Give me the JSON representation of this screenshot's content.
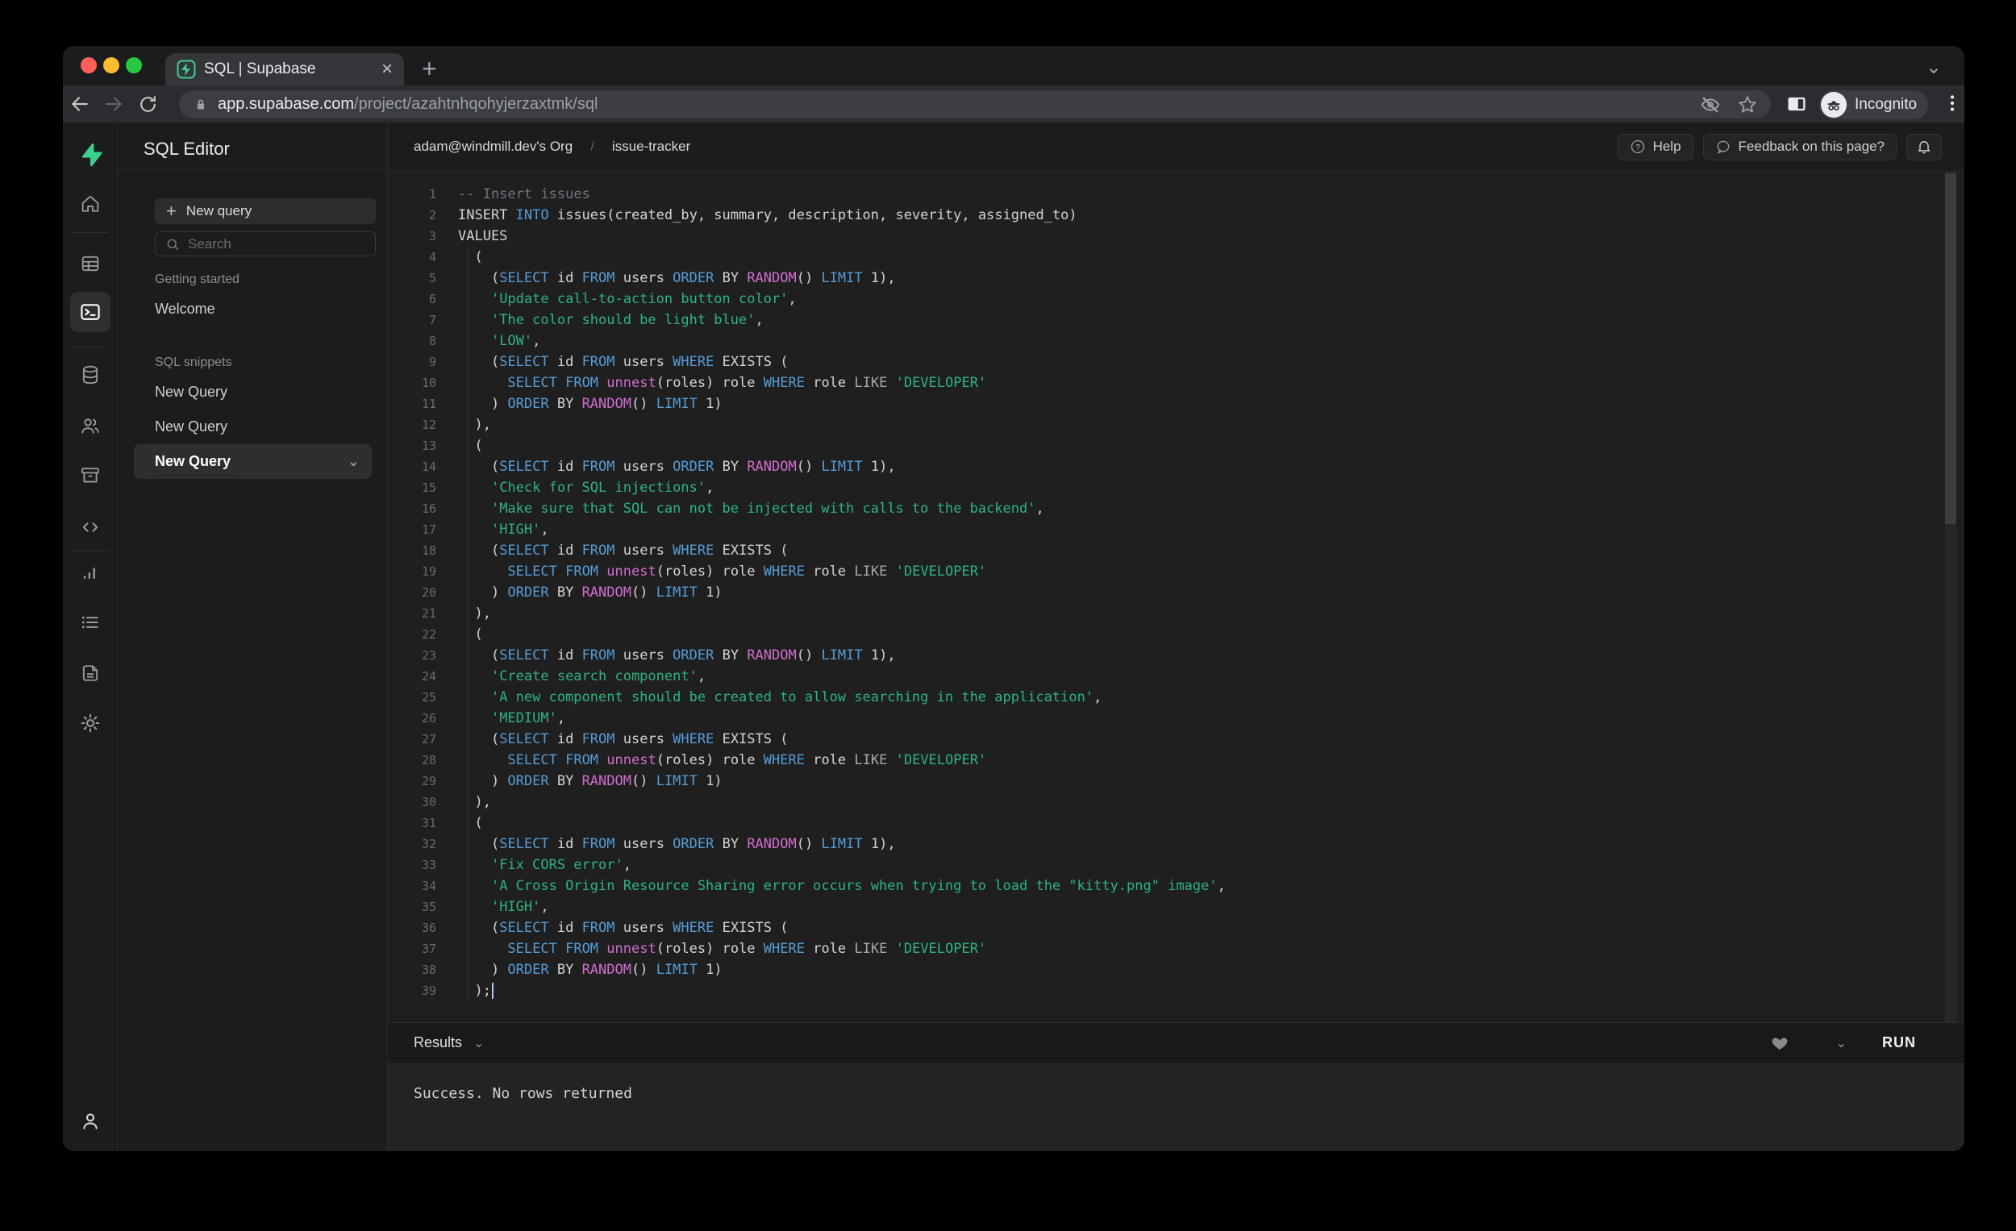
{
  "browser": {
    "tab_title": "SQL | Supabase",
    "close_glyph": "×",
    "plus_glyph": "+",
    "chevron_glyph": "⌄",
    "kebab_glyph": "⋮",
    "url_host": "app.supabase.com",
    "url_path": "/project/azahtnhqohyjerzaxtmk/sql",
    "incognito_label": "Incognito"
  },
  "header": {
    "breadcrumb_org": "adam@windmill.dev's Org",
    "breadcrumb_sep": "/",
    "breadcrumb_project": "issue-tracker",
    "help_label": "Help",
    "feedback_label": "Feedback on this page?"
  },
  "sidebar_panel": {
    "title": "SQL Editor",
    "new_query_button": "New query",
    "search_placeholder": "Search",
    "sections": [
      {
        "label": "Getting started",
        "items": [
          {
            "label": "Welcome",
            "active": false
          }
        ]
      },
      {
        "label": "SQL snippets",
        "items": [
          {
            "label": "New Query",
            "active": false
          },
          {
            "label": "New Query",
            "active": false
          },
          {
            "label": "New Query",
            "active": true
          }
        ]
      }
    ],
    "active_item_chevron": "⌄"
  },
  "results": {
    "label": "Results",
    "chevron": "⌄",
    "run_label": "RUN",
    "message": "Success. No rows returned"
  },
  "colors": {
    "accent_green": "#3ecf8e",
    "keyword_blue": "#569cd6",
    "function_magenta": "#d16dce",
    "string_green": "#2db47e",
    "comment_gray": "#6e7681",
    "mac_close": "#ff5f57",
    "mac_minimize": "#febc2e",
    "mac_zoom": "#28c840"
  },
  "editor": {
    "cursor_line": 39,
    "lines": [
      [
        [
          "c",
          "-- Insert issues"
        ]
      ],
      [
        [
          "d",
          "INSERT "
        ],
        [
          "k",
          "INTO"
        ],
        [
          "d",
          " issues(created_by, summary, description, severity, assigned_to)"
        ]
      ],
      [
        [
          "d",
          "VALUES"
        ]
      ],
      [
        [
          "d",
          "  ("
        ]
      ],
      [
        [
          "d",
          "    ("
        ],
        [
          "k",
          "SELECT"
        ],
        [
          "d",
          " id "
        ],
        [
          "k",
          "FROM"
        ],
        [
          "d",
          " users "
        ],
        [
          "k",
          "ORDER"
        ],
        [
          "d",
          " BY "
        ],
        [
          "f",
          "RANDOM"
        ],
        [
          "d",
          "() "
        ],
        [
          "k",
          "LIMIT"
        ],
        [
          "d",
          " 1),"
        ]
      ],
      [
        [
          "d",
          "    "
        ],
        [
          "s",
          "'Update call-to-action button color'"
        ],
        [
          "d",
          ","
        ]
      ],
      [
        [
          "d",
          "    "
        ],
        [
          "s",
          "'The color should be light blue'"
        ],
        [
          "d",
          ","
        ]
      ],
      [
        [
          "d",
          "    "
        ],
        [
          "s",
          "'LOW'"
        ],
        [
          "d",
          ","
        ]
      ],
      [
        [
          "d",
          "    ("
        ],
        [
          "k",
          "SELECT"
        ],
        [
          "d",
          " id "
        ],
        [
          "k",
          "FROM"
        ],
        [
          "d",
          " users "
        ],
        [
          "k",
          "WHERE"
        ],
        [
          "d",
          " EXISTS ("
        ]
      ],
      [
        [
          "d",
          "      "
        ],
        [
          "k",
          "SELECT"
        ],
        [
          "d",
          " "
        ],
        [
          "k",
          "FROM"
        ],
        [
          "d",
          " "
        ],
        [
          "f",
          "unnest"
        ],
        [
          "d",
          "(roles) role "
        ],
        [
          "k",
          "WHERE"
        ],
        [
          "d",
          " role "
        ],
        [
          "g",
          "LIKE"
        ],
        [
          "d",
          " "
        ],
        [
          "s",
          "'DEVELOPER'"
        ]
      ],
      [
        [
          "d",
          "    ) "
        ],
        [
          "k",
          "ORDER"
        ],
        [
          "d",
          " BY "
        ],
        [
          "f",
          "RANDOM"
        ],
        [
          "d",
          "() "
        ],
        [
          "k",
          "LIMIT"
        ],
        [
          "d",
          " 1)"
        ]
      ],
      [
        [
          "d",
          "  ),"
        ]
      ],
      [
        [
          "d",
          "  ("
        ]
      ],
      [
        [
          "d",
          "    ("
        ],
        [
          "k",
          "SELECT"
        ],
        [
          "d",
          " id "
        ],
        [
          "k",
          "FROM"
        ],
        [
          "d",
          " users "
        ],
        [
          "k",
          "ORDER"
        ],
        [
          "d",
          " BY "
        ],
        [
          "f",
          "RANDOM"
        ],
        [
          "d",
          "() "
        ],
        [
          "k",
          "LIMIT"
        ],
        [
          "d",
          " 1),"
        ]
      ],
      [
        [
          "d",
          "    "
        ],
        [
          "s",
          "'Check for SQL injections'"
        ],
        [
          "d",
          ","
        ]
      ],
      [
        [
          "d",
          "    "
        ],
        [
          "s",
          "'Make sure that SQL can not be injected with calls to the backend'"
        ],
        [
          "d",
          ","
        ]
      ],
      [
        [
          "d",
          "    "
        ],
        [
          "s",
          "'HIGH'"
        ],
        [
          "d",
          ","
        ]
      ],
      [
        [
          "d",
          "    ("
        ],
        [
          "k",
          "SELECT"
        ],
        [
          "d",
          " id "
        ],
        [
          "k",
          "FROM"
        ],
        [
          "d",
          " users "
        ],
        [
          "k",
          "WHERE"
        ],
        [
          "d",
          " EXISTS ("
        ]
      ],
      [
        [
          "d",
          "      "
        ],
        [
          "k",
          "SELECT"
        ],
        [
          "d",
          " "
        ],
        [
          "k",
          "FROM"
        ],
        [
          "d",
          " "
        ],
        [
          "f",
          "unnest"
        ],
        [
          "d",
          "(roles) role "
        ],
        [
          "k",
          "WHERE"
        ],
        [
          "d",
          " role "
        ],
        [
          "g",
          "LIKE"
        ],
        [
          "d",
          " "
        ],
        [
          "s",
          "'DEVELOPER'"
        ]
      ],
      [
        [
          "d",
          "    ) "
        ],
        [
          "k",
          "ORDER"
        ],
        [
          "d",
          " BY "
        ],
        [
          "f",
          "RANDOM"
        ],
        [
          "d",
          "() "
        ],
        [
          "k",
          "LIMIT"
        ],
        [
          "d",
          " 1)"
        ]
      ],
      [
        [
          "d",
          "  ),"
        ]
      ],
      [
        [
          "d",
          "  ("
        ]
      ],
      [
        [
          "d",
          "    ("
        ],
        [
          "k",
          "SELECT"
        ],
        [
          "d",
          " id "
        ],
        [
          "k",
          "FROM"
        ],
        [
          "d",
          " users "
        ],
        [
          "k",
          "ORDER"
        ],
        [
          "d",
          " BY "
        ],
        [
          "f",
          "RANDOM"
        ],
        [
          "d",
          "() "
        ],
        [
          "k",
          "LIMIT"
        ],
        [
          "d",
          " 1),"
        ]
      ],
      [
        [
          "d",
          "    "
        ],
        [
          "s",
          "'Create search component'"
        ],
        [
          "d",
          ","
        ]
      ],
      [
        [
          "d",
          "    "
        ],
        [
          "s",
          "'A new component should be created to allow searching in the application'"
        ],
        [
          "d",
          ","
        ]
      ],
      [
        [
          "d",
          "    "
        ],
        [
          "s",
          "'MEDIUM'"
        ],
        [
          "d",
          ","
        ]
      ],
      [
        [
          "d",
          "    ("
        ],
        [
          "k",
          "SELECT"
        ],
        [
          "d",
          " id "
        ],
        [
          "k",
          "FROM"
        ],
        [
          "d",
          " users "
        ],
        [
          "k",
          "WHERE"
        ],
        [
          "d",
          " EXISTS ("
        ]
      ],
      [
        [
          "d",
          "      "
        ],
        [
          "k",
          "SELECT"
        ],
        [
          "d",
          " "
        ],
        [
          "k",
          "FROM"
        ],
        [
          "d",
          " "
        ],
        [
          "f",
          "unnest"
        ],
        [
          "d",
          "(roles) role "
        ],
        [
          "k",
          "WHERE"
        ],
        [
          "d",
          " role "
        ],
        [
          "g",
          "LIKE"
        ],
        [
          "d",
          " "
        ],
        [
          "s",
          "'DEVELOPER'"
        ]
      ],
      [
        [
          "d",
          "    ) "
        ],
        [
          "k",
          "ORDER"
        ],
        [
          "d",
          " BY "
        ],
        [
          "f",
          "RANDOM"
        ],
        [
          "d",
          "() "
        ],
        [
          "k",
          "LIMIT"
        ],
        [
          "d",
          " 1)"
        ]
      ],
      [
        [
          "d",
          "  ),"
        ]
      ],
      [
        [
          "d",
          "  ("
        ]
      ],
      [
        [
          "d",
          "    ("
        ],
        [
          "k",
          "SELECT"
        ],
        [
          "d",
          " id "
        ],
        [
          "k",
          "FROM"
        ],
        [
          "d",
          " users "
        ],
        [
          "k",
          "ORDER"
        ],
        [
          "d",
          " BY "
        ],
        [
          "f",
          "RANDOM"
        ],
        [
          "d",
          "() "
        ],
        [
          "k",
          "LIMIT"
        ],
        [
          "d",
          " 1),"
        ]
      ],
      [
        [
          "d",
          "    "
        ],
        [
          "s",
          "'Fix CORS error'"
        ],
        [
          "d",
          ","
        ]
      ],
      [
        [
          "d",
          "    "
        ],
        [
          "s",
          "'A Cross Origin Resource Sharing error occurs when trying to load the \"kitty.png\" image'"
        ],
        [
          "d",
          ","
        ]
      ],
      [
        [
          "d",
          "    "
        ],
        [
          "s",
          "'HIGH'"
        ],
        [
          "d",
          ","
        ]
      ],
      [
        [
          "d",
          "    ("
        ],
        [
          "k",
          "SELECT"
        ],
        [
          "d",
          " id "
        ],
        [
          "k",
          "FROM"
        ],
        [
          "d",
          " users "
        ],
        [
          "k",
          "WHERE"
        ],
        [
          "d",
          " EXISTS ("
        ]
      ],
      [
        [
          "d",
          "      "
        ],
        [
          "k",
          "SELECT"
        ],
        [
          "d",
          " "
        ],
        [
          "k",
          "FROM"
        ],
        [
          "d",
          " "
        ],
        [
          "f",
          "unnest"
        ],
        [
          "d",
          "(roles) role "
        ],
        [
          "k",
          "WHERE"
        ],
        [
          "d",
          " role "
        ],
        [
          "g",
          "LIKE"
        ],
        [
          "d",
          " "
        ],
        [
          "s",
          "'DEVELOPER'"
        ]
      ],
      [
        [
          "d",
          "    ) "
        ],
        [
          "k",
          "ORDER"
        ],
        [
          "d",
          " BY "
        ],
        [
          "f",
          "RANDOM"
        ],
        [
          "d",
          "() "
        ],
        [
          "k",
          "LIMIT"
        ],
        [
          "d",
          " 1)"
        ]
      ],
      [
        [
          "d",
          "  );"
        ]
      ]
    ]
  }
}
